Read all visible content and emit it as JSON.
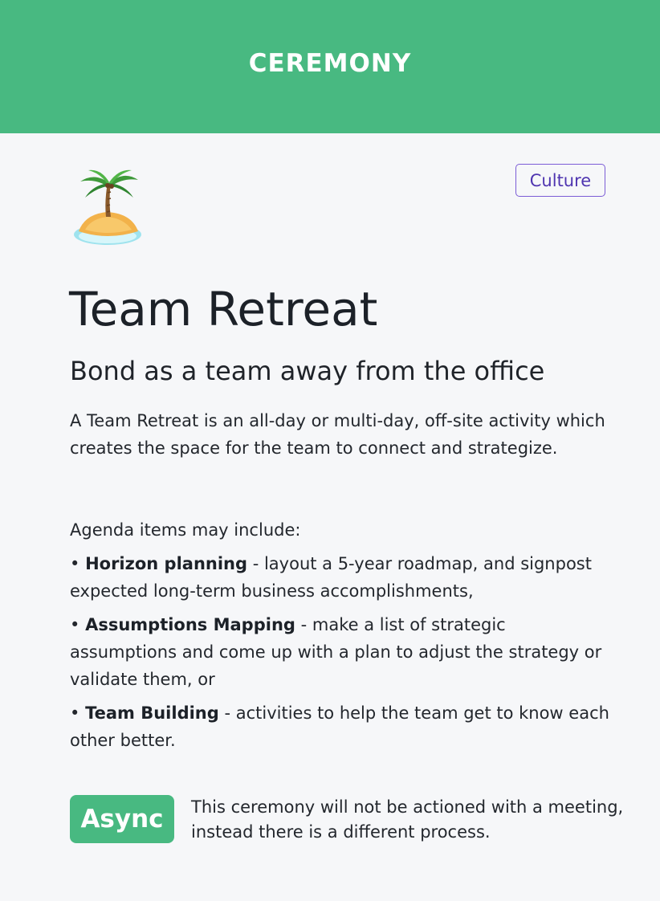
{
  "header": {
    "title": "CEREMONY"
  },
  "card": {
    "icon": "palm-tree-island-emoji",
    "tag": "Culture",
    "title": "Team Retreat",
    "subtitle": "Bond as a team away from the office",
    "description": "A Team Retreat is an all-day or multi-day, off-site activity which creates the space for the team to connect and strategize.",
    "agenda_intro": "Agenda items may include:",
    "agenda_items": [
      {
        "bullet": "•",
        "name": "Horizon planning",
        "text": " - layout a 5-year roadmap, and signpost expected long-term business accomplishments,"
      },
      {
        "bullet": "•",
        "name": "Assumptions Mapping",
        "text": " - make a list of strategic assumptions and come up with a plan to adjust the strategy or validate them, or"
      },
      {
        "bullet": "•",
        "name": "Team Building",
        "text": " - activities to help the team get to know each other better."
      }
    ],
    "async_badge": "Async",
    "async_note": "This ceremony will not be actioned with a meeting, instead there is a different process."
  },
  "colors": {
    "header_bg": "#48b981",
    "page_bg": "#f6f7f9",
    "tag_border": "#7b5cd6",
    "tag_text": "#4f35b0",
    "badge_bg": "#48b981"
  }
}
